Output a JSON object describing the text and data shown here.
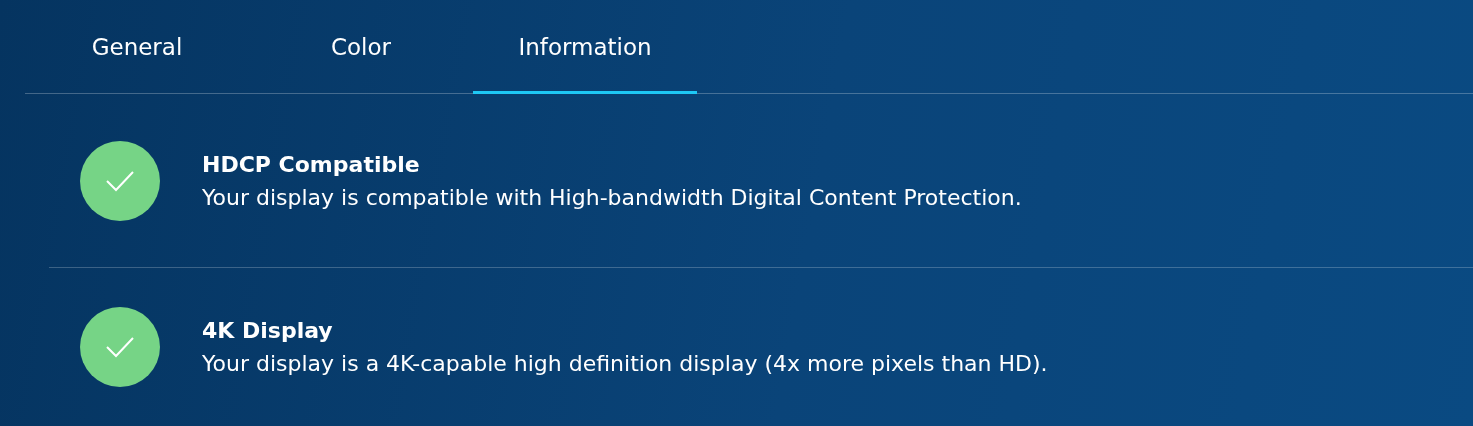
{
  "tabs": [
    {
      "label": "General",
      "selected": false
    },
    {
      "label": "Color",
      "selected": false
    },
    {
      "label": "Information",
      "selected": true
    }
  ],
  "features": [
    {
      "title": "HDCP Compatible",
      "description": "Your display is compatible with High-bandwidth Digital Content Protection.",
      "supported": true
    },
    {
      "title": "4K Display",
      "description": "Your display is a 4K-capable high definition display (4x more pixels than HD).",
      "supported": true
    }
  ]
}
